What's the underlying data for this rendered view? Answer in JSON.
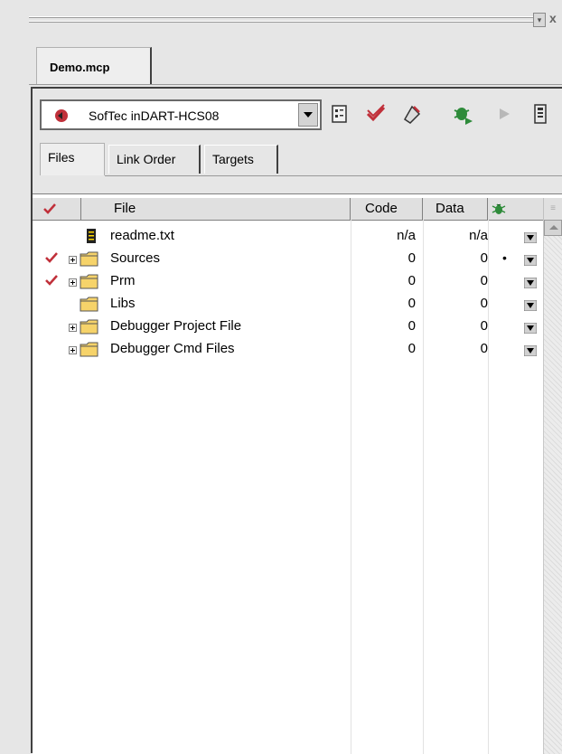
{
  "window": {
    "doc_tab": "Demo.mcp"
  },
  "toolbar": {
    "target": "SofTec inDART-HCS08",
    "icons": [
      "settings-icon",
      "check-icon",
      "build-icon",
      "debug-icon",
      "run-icon",
      "device-icon"
    ]
  },
  "tabs": [
    {
      "label": "Files",
      "active": true
    },
    {
      "label": "Link Order",
      "active": false
    },
    {
      "label": "Targets",
      "active": false
    }
  ],
  "table": {
    "headers": {
      "file": "File",
      "code": "Code",
      "data": "Data"
    },
    "rows": [
      {
        "name": "readme.txt",
        "type": "file",
        "expandable": false,
        "checked": false,
        "code": "n/a",
        "data": "n/a",
        "dot": ""
      },
      {
        "name": "Sources",
        "type": "folder",
        "expandable": true,
        "checked": true,
        "code": "0",
        "data": "0",
        "dot": "•"
      },
      {
        "name": "Prm",
        "type": "folder",
        "expandable": true,
        "checked": true,
        "code": "0",
        "data": "0",
        "dot": ""
      },
      {
        "name": "Libs",
        "type": "folder",
        "expandable": false,
        "checked": false,
        "code": "0",
        "data": "0",
        "dot": ""
      },
      {
        "name": "Debugger Project File",
        "type": "folder",
        "expandable": true,
        "checked": false,
        "code": "0",
        "data": "0",
        "dot": ""
      },
      {
        "name": "Debugger Cmd Files",
        "type": "folder",
        "expandable": true,
        "checked": false,
        "code": "0",
        "data": "0",
        "dot": ""
      }
    ]
  },
  "colors": {
    "check": "#c0303a",
    "folder": "#f6d36a",
    "debug_bug": "#2e8b3a"
  }
}
